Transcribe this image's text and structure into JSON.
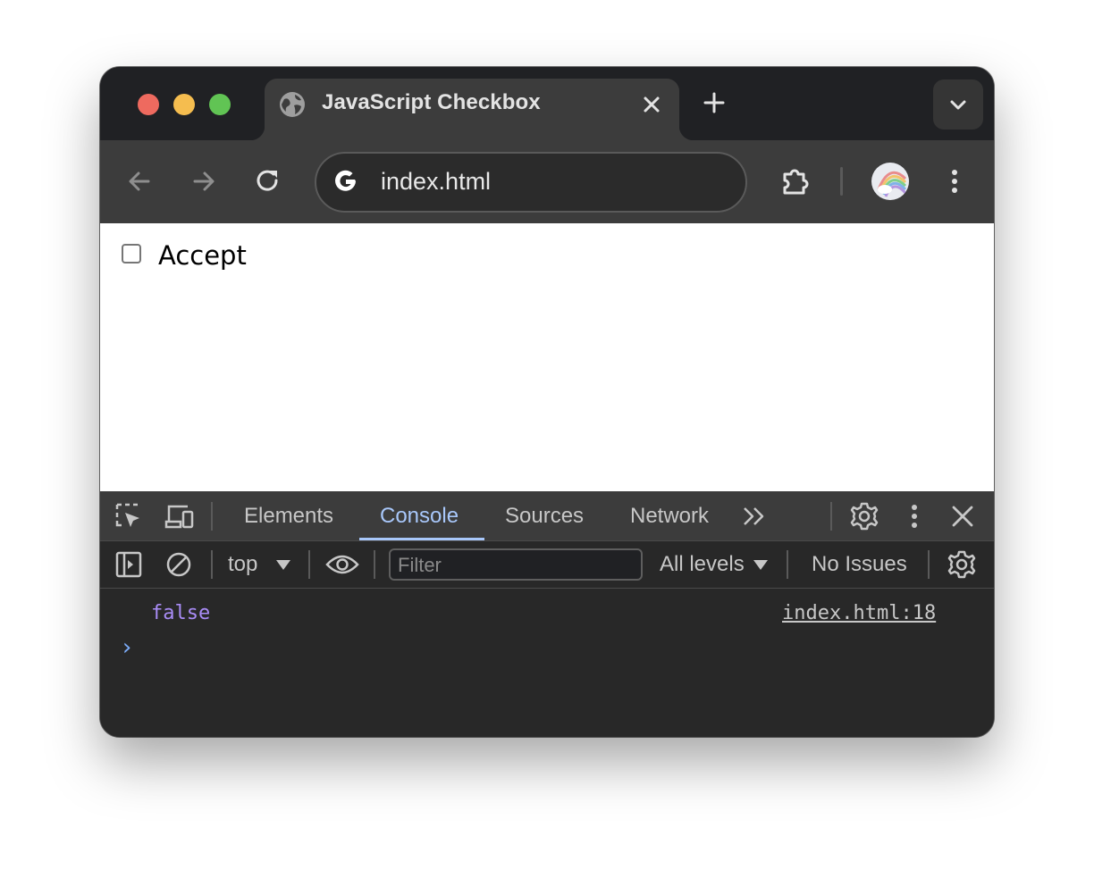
{
  "browser": {
    "tab": {
      "title": "JavaScript Checkbox"
    },
    "address_bar": {
      "url": "index.html"
    }
  },
  "page": {
    "checkbox": {
      "label": "Accept",
      "checked": false
    }
  },
  "devtools": {
    "tabs": [
      {
        "label": "Elements"
      },
      {
        "label": "Console"
      },
      {
        "label": "Sources"
      },
      {
        "label": "Network"
      }
    ],
    "active_tab": "Console",
    "console_toolbar": {
      "context": "top",
      "filter_placeholder": "Filter",
      "levels": "All levels",
      "issues": "No Issues"
    },
    "console": {
      "messages": [
        {
          "value": "false",
          "source": "index.html:18"
        }
      ],
      "prompt": "›"
    }
  },
  "colors": {
    "traffic_red": "#ee6a5f",
    "traffic_yellow": "#f5bd4f",
    "traffic_green": "#61c454",
    "active_tab_accent": "#a8c7fa",
    "console_boolean": "#a98cf6"
  },
  "icons": [
    "globe-icon",
    "close-icon",
    "plus-icon",
    "chevron-down-icon",
    "back-arrow-icon",
    "forward-arrow-icon",
    "reload-icon",
    "google-g-icon",
    "extensions-puzzle-icon",
    "profile-avatar",
    "more-vert-icon",
    "inspect-element-icon",
    "device-toolbar-icon",
    "settings-gear-icon",
    "sidebar-toggle-icon",
    "clear-console-icon",
    "eye-icon"
  ]
}
